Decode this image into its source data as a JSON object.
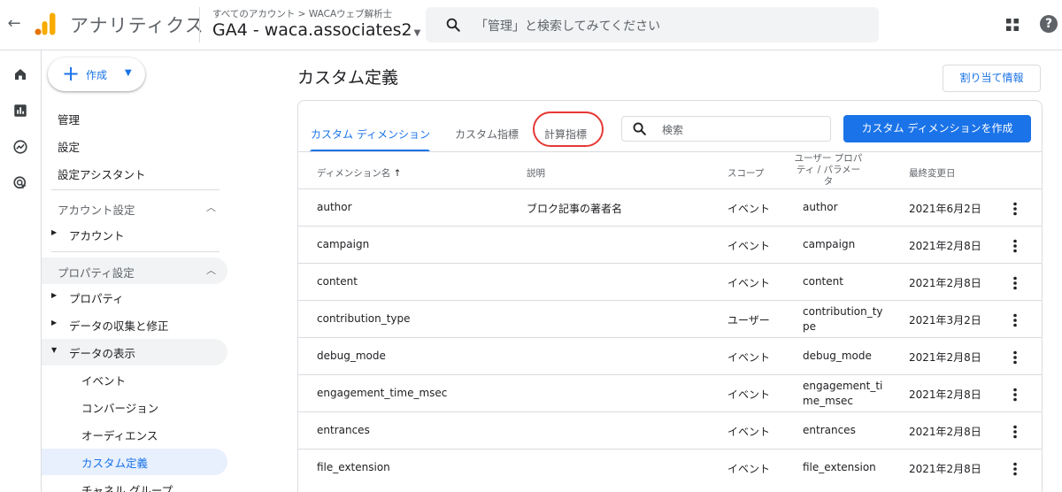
{
  "header": {
    "back_icon": "arrow-left-icon",
    "app_name": "アナリティクス",
    "breadcrumb": "すべてのアカウント > WACAウェブ解析士",
    "property": "GA4 - waca.associates2",
    "search_placeholder": "「管理」と検索してみてください",
    "help_symbol": "?"
  },
  "sidebar": {
    "create_label": "作成",
    "top_items": [
      "管理",
      "設定",
      "設定アシスタント"
    ],
    "account_section": "アカウント設定",
    "account_item": "アカウント",
    "property_section": "プロパティ設定",
    "property_items": [
      "プロパティ",
      "データの収集と修正",
      "データの表示"
    ],
    "display_items": [
      "イベント",
      "コンバージョン",
      "オーディエンス",
      "カスタム定義",
      "チャネル グループ"
    ]
  },
  "main": {
    "page_title": "カスタム定義",
    "assign_button": "割り当て情報",
    "tabs": [
      "カスタム ディメンション",
      "カスタム指標",
      "計算指標"
    ],
    "search_placeholder": "検索",
    "create_button": "カスタム ディメンションを作成",
    "columns": {
      "name": "ディメンション名",
      "sort_arrow": "↑",
      "description": "説明",
      "scope": "スコープ",
      "user_prop": "ユーザー プロパティ / パラメータ",
      "modified": "最終変更日"
    },
    "rows": [
      {
        "name": "author",
        "description": "ブロク記事の著者名",
        "scope": "イベント",
        "param": "author",
        "date": "2021年6月2日"
      },
      {
        "name": "campaign",
        "description": "",
        "scope": "イベント",
        "param": "campaign",
        "date": "2021年2月8日"
      },
      {
        "name": "content",
        "description": "",
        "scope": "イベント",
        "param": "content",
        "date": "2021年2月8日"
      },
      {
        "name": "contribution_type",
        "description": "",
        "scope": "ユーザー",
        "param": "contribution_type",
        "date": "2021年3月2日"
      },
      {
        "name": "debug_mode",
        "description": "",
        "scope": "イベント",
        "param": "debug_mode",
        "date": "2021年2月8日"
      },
      {
        "name": "engagement_time_msec",
        "description": "",
        "scope": "イベント",
        "param": "engagement_time_msec",
        "date": "2021年2月8日"
      },
      {
        "name": "entrances",
        "description": "",
        "scope": "イベント",
        "param": "entrances",
        "date": "2021年2月8日"
      },
      {
        "name": "file_extension",
        "description": "",
        "scope": "イベント",
        "param": "file_extension",
        "date": "2021年2月8日"
      }
    ]
  },
  "colors": {
    "accent": "#1a73e8",
    "logo_orange": "#f9ab00",
    "logo_dark_orange": "#e37400",
    "highlight_ring": "#e53935"
  }
}
